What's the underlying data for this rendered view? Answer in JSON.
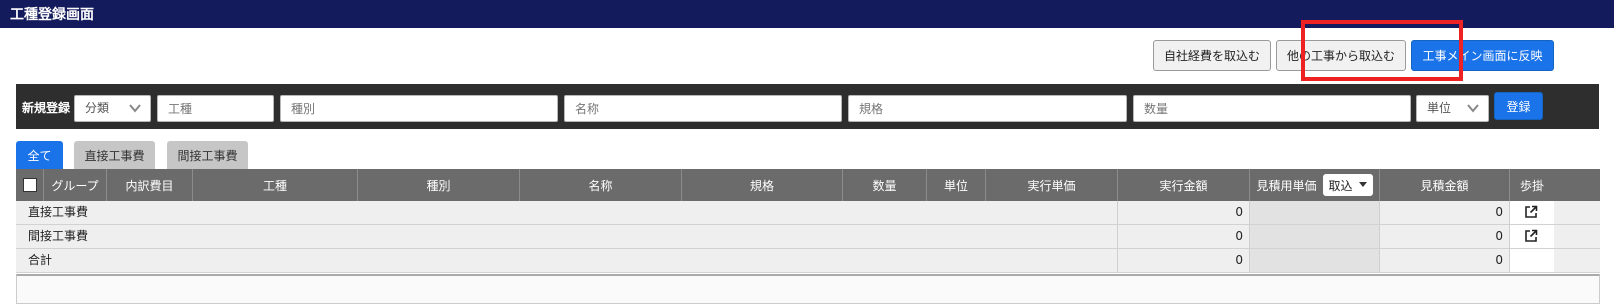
{
  "window": {
    "title": "工種登録画面"
  },
  "actions": {
    "import_own_expenses": "自社経費を取込む",
    "import_other_work": "他の工事から取込む",
    "reflect_main": "工事メイン画面に反映"
  },
  "new_entry": {
    "label": "新規登録",
    "category_select": "分類",
    "placeholders": {
      "work_type": "工種",
      "kind": "種別",
      "name": "名称",
      "spec": "規格",
      "quantity": "数量"
    },
    "unit_select": "単位",
    "register_button": "登録"
  },
  "tabs": [
    {
      "label": "全て",
      "active": true
    },
    {
      "label": "直接工事費",
      "active": false
    },
    {
      "label": "間接工事費",
      "active": false
    }
  ],
  "table": {
    "headers": {
      "group": "グループ",
      "breakdown": "内訳費目",
      "work_type": "工種",
      "kind": "種別",
      "name": "名称",
      "spec": "規格",
      "quantity": "数量",
      "unit": "単位",
      "exec_unit_price": "実行単価",
      "exec_amount": "実行金額",
      "est_unit_price": "見積用単価",
      "est_dropdown": "取込",
      "est_amount": "見積金額",
      "progress": "歩掛"
    },
    "rows": [
      {
        "label": "直接工事費",
        "exec_amount": "0",
        "est_amount": "0",
        "has_link": true
      },
      {
        "label": "間接工事費",
        "exec_amount": "0",
        "est_amount": "0",
        "has_link": true
      },
      {
        "label": "合計",
        "exec_amount": "0",
        "est_amount": "0",
        "has_link": false
      }
    ]
  },
  "colors": {
    "titlebar": "#141b5c",
    "accent": "#1a73e8",
    "highlight": "#ee2222",
    "header": "#6b6b6b"
  },
  "icons": {
    "external_link": "external-link-icon",
    "select_chevron": "chevron-down-icon",
    "caret": "caret-down-icon"
  }
}
